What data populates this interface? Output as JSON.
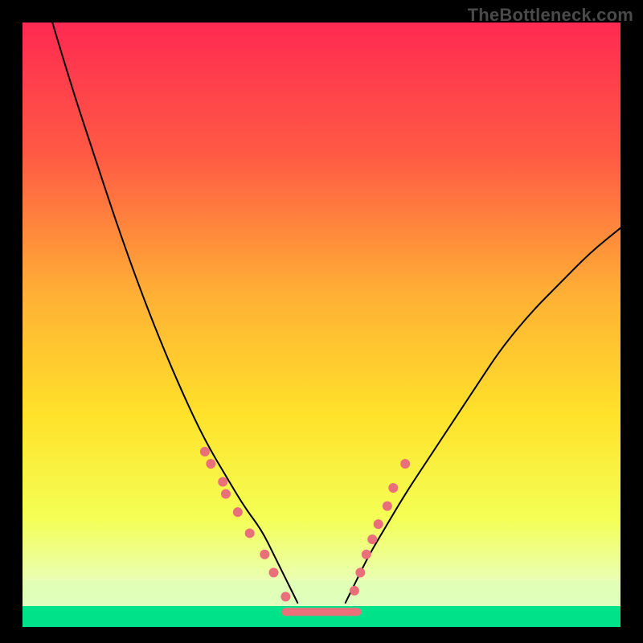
{
  "watermark": "TheBottleneck.com",
  "chart_data": {
    "type": "line",
    "title": "",
    "xlabel": "",
    "ylabel": "",
    "xlim": [
      0,
      100
    ],
    "ylim": [
      0,
      100
    ],
    "grid": false,
    "legend": false,
    "background_gradient": {
      "top_color": "#ff2a52",
      "mid_colors": [
        "#ff6a3a",
        "#ffd400",
        "#f6ff66"
      ],
      "bottom_band_color": "#00e28a"
    },
    "series": [
      {
        "name": "left-curve",
        "color": "#000000",
        "stroke_width": 2,
        "x": [
          5,
          8,
          12,
          16,
          20,
          24,
          28,
          31,
          34,
          37,
          40,
          42,
          44,
          46
        ],
        "y": [
          100,
          90,
          78,
          66,
          55,
          45,
          36,
          30,
          25,
          20,
          16,
          12,
          8,
          4
        ]
      },
      {
        "name": "right-curve",
        "color": "#000000",
        "stroke_width": 2,
        "x": [
          54,
          56,
          58,
          61,
          64,
          68,
          72,
          76,
          80,
          85,
          90,
          95,
          100
        ],
        "y": [
          4,
          8,
          12,
          17,
          22,
          28,
          34,
          40,
          46,
          52,
          57,
          62,
          66
        ]
      },
      {
        "name": "valley-floor-highlight",
        "type": "segment",
        "color": "#e96f7a",
        "stroke_width": 10,
        "x": [
          44,
          56
        ],
        "y": [
          2.5,
          2.5
        ]
      }
    ],
    "markers": {
      "color": "#e96f7a",
      "radius": 6,
      "points": [
        {
          "x": 30.5,
          "y": 29
        },
        {
          "x": 31.5,
          "y": 27
        },
        {
          "x": 33.5,
          "y": 24
        },
        {
          "x": 34.0,
          "y": 22
        },
        {
          "x": 36.0,
          "y": 19
        },
        {
          "x": 38.0,
          "y": 15.5
        },
        {
          "x": 40.5,
          "y": 12
        },
        {
          "x": 42.0,
          "y": 9
        },
        {
          "x": 44.0,
          "y": 5
        },
        {
          "x": 55.5,
          "y": 6
        },
        {
          "x": 56.5,
          "y": 9
        },
        {
          "x": 57.5,
          "y": 12
        },
        {
          "x": 58.5,
          "y": 14.5
        },
        {
          "x": 59.5,
          "y": 17
        },
        {
          "x": 61.0,
          "y": 20
        },
        {
          "x": 62.0,
          "y": 23
        },
        {
          "x": 64.0,
          "y": 27
        }
      ]
    }
  }
}
